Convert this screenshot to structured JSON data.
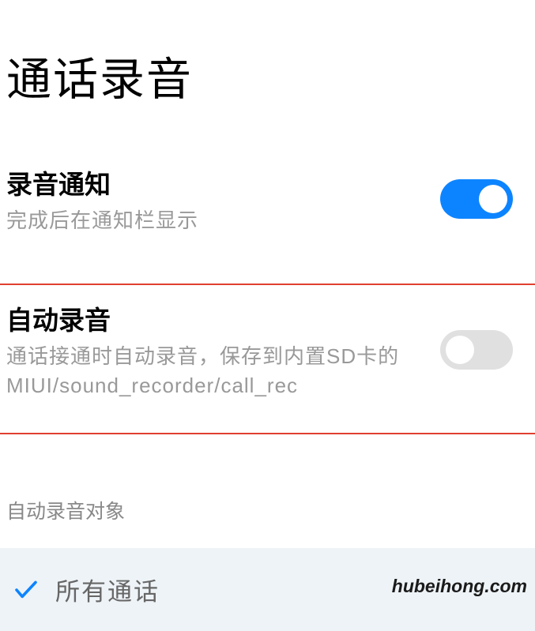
{
  "page": {
    "title": "通话录音"
  },
  "settings": {
    "recording_notification": {
      "title": "录音通知",
      "subtitle": "完成后在通知栏显示",
      "enabled": true
    },
    "auto_recording": {
      "title": "自动录音",
      "subtitle": "通话接通时自动录音，保存到内置SD卡的MIUI/sound_recorder/call_rec",
      "enabled": false
    }
  },
  "section_header": "自动录音对象",
  "radio_option": {
    "label": "所有通话",
    "selected": true
  },
  "watermark": "hubeihong.com"
}
